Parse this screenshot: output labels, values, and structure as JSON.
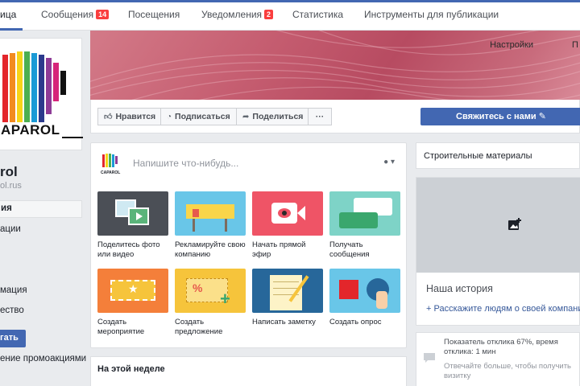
{
  "topnav": {
    "tabs": [
      {
        "label": "ица",
        "badge": null
      },
      {
        "label": "Сообщения",
        "badge": "14"
      },
      {
        "label": "Посещения",
        "badge": null
      },
      {
        "label": "Уведомления",
        "badge": "2"
      },
      {
        "label": "Статистика",
        "badge": null
      },
      {
        "label": "Инструменты для публикации",
        "badge": null
      }
    ]
  },
  "cover": {
    "settings_label": "Настройки",
    "help_label": "П"
  },
  "left": {
    "logo_text": "APAROL",
    "page_name": "rol",
    "username": "ol.rus",
    "nav_items": [
      "ия",
      "ации",
      "мация",
      "ество"
    ],
    "promote_button": "гать",
    "promotions_link": "ение промоакциями"
  },
  "actions": {
    "like": "Нравится",
    "subscribe": "Подписаться",
    "share": "Поделиться",
    "more": "···",
    "contact": "Свяжитесь с нами"
  },
  "composer": {
    "placeholder": "Напишите что-нибудь...",
    "mini_logo": "CAPAROL",
    "tiles": [
      {
        "caption": "Поделитесь фото или видео",
        "color": "#4b4f56"
      },
      {
        "caption": "Рекламируйте свою компанию",
        "color": "#69c6e8"
      },
      {
        "caption": "Начать прямой эфир",
        "color": "#ef5466"
      },
      {
        "caption": "Получать сообщения",
        "color": "#7ed3c7"
      },
      {
        "caption": "Создать мероприятие",
        "color": "#f47f3a"
      },
      {
        "caption": "Создать предложение",
        "color": "#f6c43b"
      },
      {
        "caption": "Написать заметку",
        "color": "#27679a"
      },
      {
        "caption": "Создать опрос",
        "color": "#69c6e8"
      }
    ]
  },
  "week": {
    "title": "На этой неделе"
  },
  "right": {
    "category": "Строительные материалы",
    "story_title": "Наша история",
    "story_link": "+ Расскажите людям о своей компании",
    "response_text": "Показатель отклика 67%, время отклика: 1 мин",
    "response_hint": "Отвечайте больше, чтобы получить визитку"
  }
}
